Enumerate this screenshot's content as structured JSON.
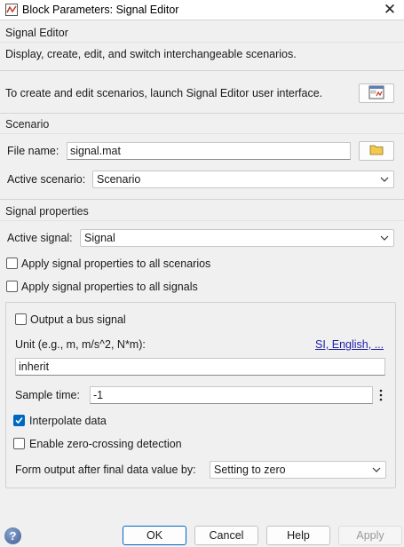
{
  "window": {
    "title": "Block Parameters: Signal Editor",
    "close_icon": "close-icon"
  },
  "header": {
    "block_name": "Signal Editor",
    "description": "Display, create, edit, and switch interchangeable scenarios."
  },
  "launch": {
    "text": "To create and edit scenarios, launch Signal Editor user interface.",
    "button_icon": "signal-editor-launch-icon"
  },
  "scenario": {
    "section_title": "Scenario",
    "file_name_label": "File name:",
    "file_name_value": "signal.mat",
    "browse_icon": "folder-icon",
    "active_scenario_label": "Active scenario:",
    "active_scenario_value": "Scenario"
  },
  "signal_properties": {
    "section_title": "Signal properties",
    "active_signal_label": "Active signal:",
    "active_signal_value": "Signal",
    "apply_all_scenarios_label": "Apply signal properties to all scenarios",
    "apply_all_scenarios_checked": false,
    "apply_all_signals_label": "Apply signal properties to all signals",
    "apply_all_signals_checked": false,
    "output_bus_label": "Output a bus signal",
    "output_bus_checked": false,
    "unit_label": "Unit (e.g., m, m/s^2, N*m):",
    "unit_link": "SI, English, ...",
    "unit_value": "inherit",
    "sample_time_label": "Sample time:",
    "sample_time_value": "-1",
    "interpolate_label": "Interpolate data",
    "interpolate_checked": true,
    "zero_crossing_label": "Enable zero-crossing detection",
    "zero_crossing_checked": false,
    "form_output_label": "Form output after final data value by:",
    "form_output_value": "Setting to zero"
  },
  "footer": {
    "ok": "OK",
    "cancel": "Cancel",
    "help": "Help",
    "apply": "Apply",
    "help_glyph": "?"
  },
  "colors": {
    "accent": "#0067c0",
    "link": "#1f1fa8",
    "background": "#f0f0f0"
  }
}
